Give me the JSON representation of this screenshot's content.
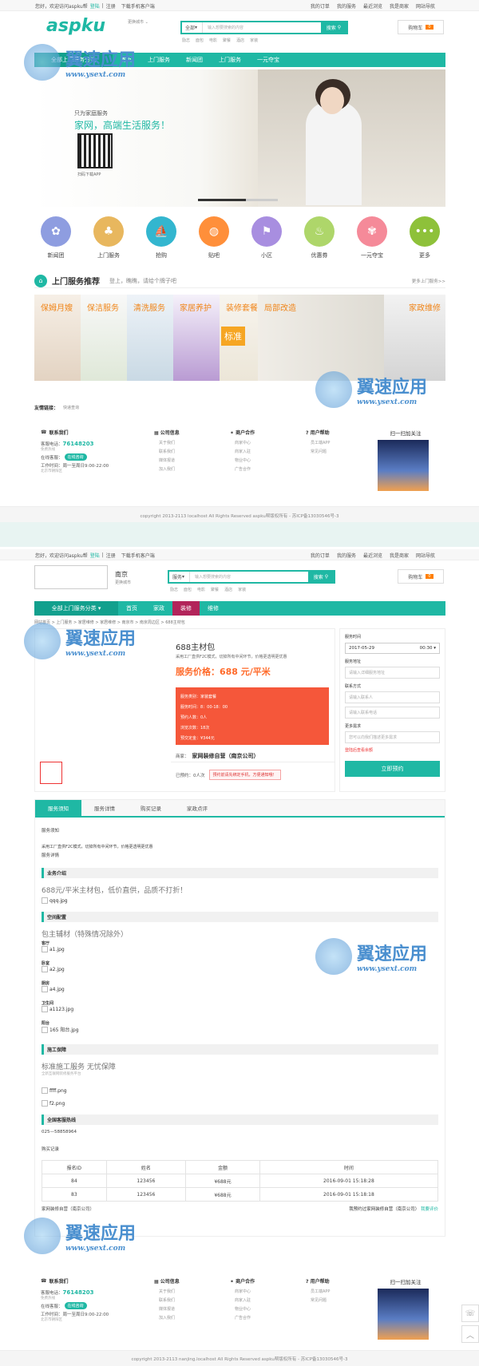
{
  "topbar": {
    "welcome": "您好，欢迎访问aspku帮",
    "login": "登陆",
    "register": "注册",
    "app": "下载手机客户端",
    "links": [
      "我的订单",
      "我的服务",
      "最近浏览",
      "我是商家",
      "网站导航"
    ]
  },
  "header": {
    "logo": "aspku",
    "city_switch": "更换城市",
    "search": {
      "scope": "全部",
      "placeholder": "输入想要搜索的内容",
      "button": "搜索",
      "hotwords": [
        "励志",
        "面包",
        "电影",
        "聚餐",
        "酒店",
        "家装"
      ]
    },
    "cart": {
      "label": "购物车",
      "count": "0"
    }
  },
  "nav1": {
    "items": [
      "全部上门服务分类",
      "首页",
      "上门服务",
      "新闻团",
      "上门服务",
      "一元夺宝"
    ]
  },
  "banner": {
    "line1": "只为家庭服务",
    "line2": "家网，高端生活服务！",
    "qr_caption": "扫码下载APP"
  },
  "categories": [
    {
      "label": "新闻团",
      "color": "#8e9de0",
      "glyph": "✿"
    },
    {
      "label": "上门服务",
      "color": "#e8b75e",
      "glyph": "♣"
    },
    {
      "label": "抢购",
      "color": "#33b6cf",
      "glyph": "⛵"
    },
    {
      "label": "贴吧",
      "color": "#ff8f3a",
      "glyph": "◍"
    },
    {
      "label": "小区",
      "color": "#a88ee0",
      "glyph": "⚑"
    },
    {
      "label": "优惠券",
      "color": "#aed66a",
      "glyph": "♨"
    },
    {
      "label": "一元夺宝",
      "color": "#f58a99",
      "glyph": "✾"
    },
    {
      "label": "更多",
      "color": "#8ec13a",
      "glyph": "•••"
    }
  ],
  "recommend": {
    "title": "上门服务推荐",
    "slogan": "登上，瞧瞧，请给个牌子吧",
    "more": "更多上门服务>>",
    "tiles": [
      "保姆月嫂",
      "保洁服务",
      "清洗服务",
      "家居养护",
      "装修套餐",
      "局部改造",
      "家政维修"
    ],
    "banner_word": "标准"
  },
  "friendlinks": {
    "title": "友情链接：",
    "item": "快递查询"
  },
  "footer": {
    "contact_title": "联系我们",
    "phone_label": "客服电话：",
    "phone": "76148203",
    "free": "免费热线",
    "online": "在线客服：",
    "online_btn": "在线咨询",
    "hours": "工作时间：周一至周日9:00-22:00",
    "addr": "北京市朝阳区",
    "cols": [
      {
        "title": "公司信息",
        "items": [
          "关于我们",
          "联系我们",
          "媒体报道",
          "加入我们"
        ]
      },
      {
        "title": "商户合作",
        "items": [
          "商家中心",
          "商家入驻",
          "物业中心",
          "广告合作"
        ]
      },
      {
        "title": "用户帮助",
        "items": [
          "员工端APP",
          "常见问题"
        ]
      }
    ],
    "scan": "扫一扫加关注",
    "copyright1": "copyright 2013-2113 localhost All Rights Reserved aspku帮版权所有 - 苏ICP备13030546号-3",
    "copyright2": "copyright 2013-2113 nanjing.localhost All Rights Reserved aspku帮版权所有 - 苏ICP备13030546号-3"
  },
  "page2": {
    "city": "南京",
    "city_switch": "更换城市",
    "search_scope": "服务",
    "nav": [
      "全部上门服务分类",
      "首页",
      "家政",
      "装修",
      "维修"
    ],
    "breadcrumb": "网站首页 > 上门服务 > 家居维修 > 家居维修 > 南京市 > 南京周边区 > 688主材包",
    "product": {
      "title": "688主材包",
      "desc": "采用工厂直供F2C模式，切掉所有中间环节，价格更透明更优惠",
      "price": "服务价格：688 元/平米",
      "info": [
        "服务类别：家装套餐",
        "服务时间：8：00-18：00",
        "预约人数：0人",
        "浏览次数：18次",
        "预交定金：¥344元"
      ],
      "shop_label": "商家：",
      "shop": "家网装修自营（南京公司）",
      "booked": "已预约：0人次",
      "notice": "预约前请先绑定手机，方便通知哦！"
    },
    "form": {
      "time_label": "服务时间",
      "date": "2017-05-29",
      "time": "00:30",
      "addr_label": "服务地址",
      "addr_ph": "请输入详细服务地址",
      "contact_label": "联系方式",
      "name_ph": "请输入联系人",
      "phone_ph": "请输入联系电话",
      "more_label": "更多需求",
      "more_ph": "您可以向我们描述更多需求",
      "login_hint": "登陆后查看余额",
      "submit": "立即预约"
    },
    "tabs": [
      "服务须知",
      "服务详情",
      "购买记录",
      "家政点评"
    ],
    "content": {
      "h1": "服务须知",
      "p1": "采用工厂直供F2C模式，切掉所有中间环节，价格更透明更优惠",
      "h2": "服务详情",
      "sec1": "业务介绍",
      "sec1_big": "688元/平米主材包，低价直供，品质不打折！",
      "img1": "qqq.jpg",
      "sec2": "空间配置",
      "sec2_big": "包主辅材（特殊情况除外）",
      "rooms": [
        {
          "name": "客厅",
          "img": "a1.jpg"
        },
        {
          "name": "卧室",
          "img": "a2.jpg"
        },
        {
          "name": "厨房",
          "img": "a4.jpg"
        },
        {
          "name": "卫生间",
          "img": "a1123.jpg"
        },
        {
          "name": "阳台",
          "img": "165 阳台.jpg"
        }
      ],
      "sec3": "施工保障",
      "sec3_big": "标准施工服务 无忧保障",
      "sec3_sub": "全新互联网装修服务平台",
      "imgs3": [
        "ffff.png",
        "f2.png"
      ],
      "sec4": "全国客服热线",
      "hotline": "025—58858964",
      "records_title": "购买记录",
      "table_head": [
        "报名ID",
        "姓名",
        "金额",
        "时间"
      ],
      "table_rows": [
        [
          "84",
          "123456",
          "¥688元",
          "2016-09-01 15:18:28"
        ],
        [
          "83",
          "123456",
          "¥688元",
          "2016-09-01 15:18:18"
        ]
      ],
      "review_left": "家网装修自营（南京公司）",
      "review_right": "我预约过家网装修自营（南京公司）",
      "review_link": "我要评价"
    }
  },
  "watermark": {
    "cn": "翼速应用",
    "url": "www.ysext.com"
  }
}
